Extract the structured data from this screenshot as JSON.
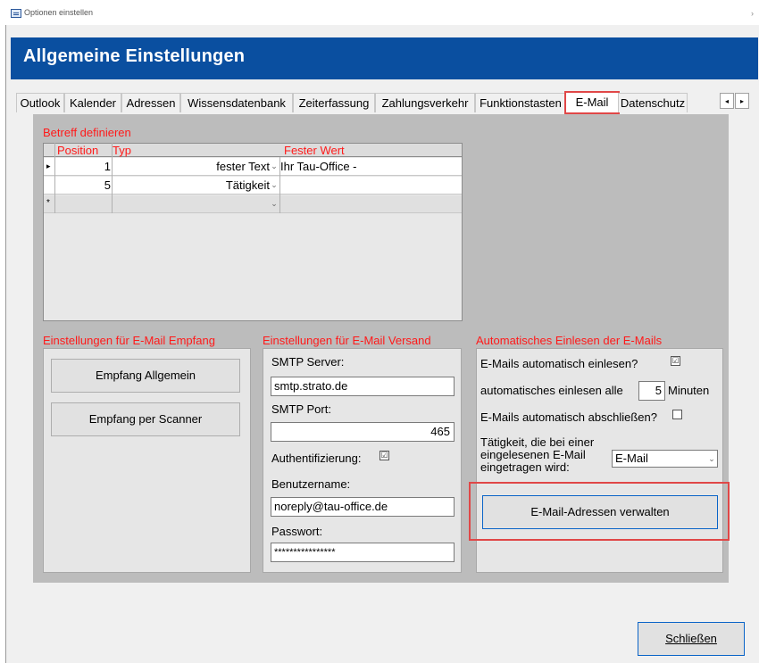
{
  "window": {
    "title": "Optionen einstellen",
    "close_glyph": "›"
  },
  "banner": {
    "title": "Allgemeine Einstellungen"
  },
  "tabs": [
    {
      "label": "Outlook"
    },
    {
      "label": "Kalender"
    },
    {
      "label": "Adressen"
    },
    {
      "label": "Wissensdatenbank"
    },
    {
      "label": "Zeiterfassung"
    },
    {
      "label": "Zahlungsverkehr"
    },
    {
      "label": "Funktionstasten"
    },
    {
      "label": "E-Mail"
    },
    {
      "label": "Datenschutz"
    }
  ],
  "tab_scroll": {
    "left": "◂",
    "right": "▸"
  },
  "subject": {
    "heading": "Betreff definieren",
    "columns": [
      "Position",
      "Typ",
      "Fester Wert"
    ],
    "rows": [
      {
        "marker": "▸",
        "position": "1",
        "type": "fester Text",
        "value": "Ihr Tau-Office -"
      },
      {
        "marker": "",
        "position": "5",
        "type": "Tätigkeit",
        "value": ""
      },
      {
        "marker": "*",
        "position": "",
        "type": "",
        "value": ""
      }
    ]
  },
  "receive": {
    "heading": "Einstellungen für E-Mail Empfang",
    "btn_general": "Empfang Allgemein",
    "btn_scanner": "Empfang per Scanner"
  },
  "send": {
    "heading": "Einstellungen für E-Mail Versand",
    "smtp_server_label": "SMTP Server:",
    "smtp_server_value": "smtp.strato.de",
    "smtp_port_label": "SMTP Port:",
    "smtp_port_value": "465",
    "auth_label": "Authentifizierung:",
    "auth_checked": "☑",
    "user_label": "Benutzername:",
    "user_value": "noreply@tau-office.de",
    "password_label": "Passwort:",
    "password_value": "****************"
  },
  "auto": {
    "heading": "Automatisches Einlesen der E-Mails",
    "auto_read_label": "E-Mails automatisch einlesen?",
    "auto_read_checked": "☑",
    "interval_label": "automatisches einlesen alle",
    "interval_value": "5",
    "interval_unit": "Minuten",
    "auto_close_label": "E-Mails automatisch abschließen?",
    "activity_label_1": "Tätigkeit, die bei einer",
    "activity_label_2": "eingelesenen E-Mail",
    "activity_label_3": "eingetragen wird:",
    "activity_value": "E-Mail",
    "manage_button": "E-Mail-Adressen verwalten"
  },
  "footer": {
    "close_button": "Schließen"
  }
}
